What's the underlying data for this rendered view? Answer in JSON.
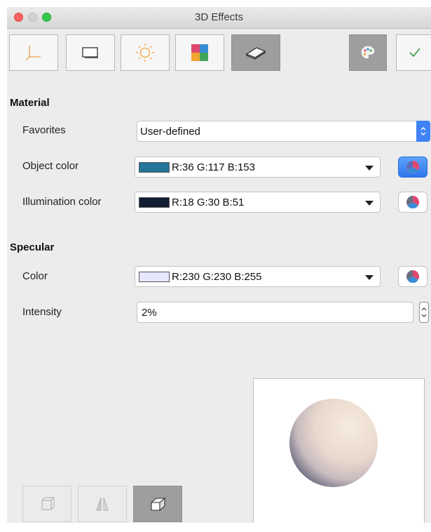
{
  "window": {
    "title": "3D Effects"
  },
  "toolbar": {
    "buttons": [
      {
        "name": "geometry-tab",
        "icon": "axes-icon"
      },
      {
        "name": "shading-tab",
        "icon": "shading-icon"
      },
      {
        "name": "illumination-tab",
        "icon": "light-bulb-icon"
      },
      {
        "name": "textures-tab",
        "icon": "texture-icon"
      },
      {
        "name": "material-tab",
        "icon": "material-icon",
        "active": true
      },
      {
        "name": "convert-3d-button",
        "icon": "palette-icon"
      },
      {
        "name": "assign-button",
        "icon": "checkmark-icon"
      }
    ]
  },
  "material": {
    "heading": "Material",
    "favorites": {
      "label": "Favorites",
      "value": "User-defined"
    },
    "object_color": {
      "label": "Object color",
      "value": "R:36 G:117 B:153",
      "swatch": "#247599"
    },
    "illumination_color": {
      "label": "Illumination color",
      "value": "R:18 G:30 B:51",
      "swatch": "#121e33"
    }
  },
  "specular": {
    "heading": "Specular",
    "color": {
      "label": "Color",
      "value": "R:230 G:230 B:255",
      "swatch": "#e6e6ff"
    },
    "intensity": {
      "label": "Intensity",
      "value": "2%"
    }
  },
  "bottom": {
    "buttons": [
      {
        "name": "convert-to-3d-button",
        "icon": "cube-convert-icon"
      },
      {
        "name": "lathe-object-button",
        "icon": "lathe-icon"
      },
      {
        "name": "perspective-button",
        "icon": "perspective-cube-icon",
        "active": true
      }
    ]
  },
  "colors": {
    "accent": "#3f82f6",
    "active_tab": "#9e9e9e"
  }
}
